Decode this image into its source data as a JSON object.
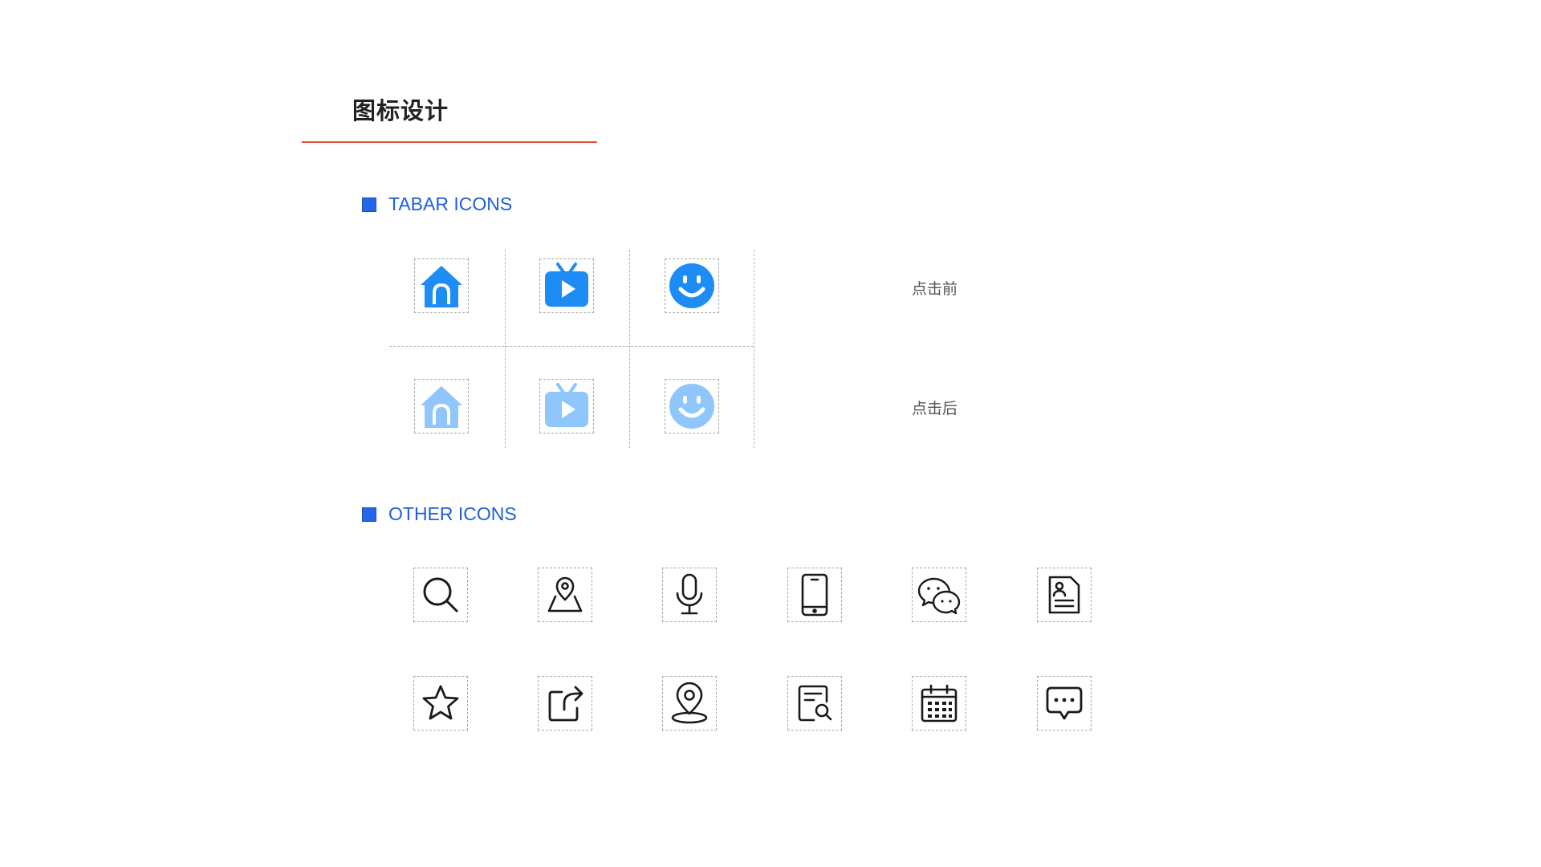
{
  "page": {
    "title": "图标设计"
  },
  "colors": {
    "accent_line": "#e8532f",
    "section_blue": "#1f5fd8",
    "icon_active": "#1d8cf5",
    "icon_inactive": "#8fc6fb"
  },
  "sections": {
    "tabar": {
      "title": "TABAR ICONS"
    },
    "other": {
      "title": "OTHER ICONS"
    }
  },
  "tabar": {
    "state_before": "点击前",
    "state_after": "点击后",
    "icons": [
      "home-icon",
      "tv-play-icon",
      "smiley-icon"
    ]
  },
  "other_icons": {
    "row1": [
      "search-icon",
      "map-pin-icon",
      "microphone-icon",
      "mobile-phone-icon",
      "wechat-icon",
      "contact-document-icon"
    ],
    "row2": [
      "star-icon",
      "share-icon",
      "location-icon",
      "document-search-icon",
      "calendar-icon",
      "message-icon"
    ]
  }
}
